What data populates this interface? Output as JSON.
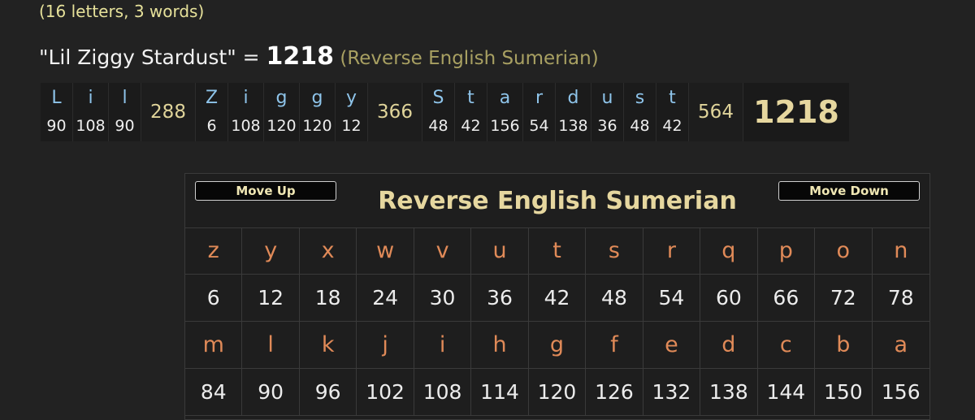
{
  "counts_text": "(16 letters, 3 words)",
  "phrase": {
    "quoted": "\"Lil Ziggy Stardust\"",
    "equals": " = ",
    "total": "1218",
    "cipher_ref": " (Reverse English Sumerian)"
  },
  "breakdown": {
    "words": [
      {
        "letters": [
          [
            "L",
            "90"
          ],
          [
            "i",
            "108"
          ],
          [
            "l",
            "90"
          ]
        ],
        "total": "288"
      },
      {
        "letters": [
          [
            "Z",
            "6"
          ],
          [
            "i",
            "108"
          ],
          [
            "g",
            "120"
          ],
          [
            "g",
            "120"
          ],
          [
            "y",
            "12"
          ]
        ],
        "total": "366"
      },
      {
        "letters": [
          [
            "S",
            "48"
          ],
          [
            "t",
            "42"
          ],
          [
            "a",
            "156"
          ],
          [
            "r",
            "54"
          ],
          [
            "d",
            "138"
          ],
          [
            "u",
            "36"
          ],
          [
            "s",
            "48"
          ],
          [
            "t",
            "42"
          ]
        ],
        "total": "564"
      }
    ],
    "grand_total": "1218"
  },
  "cipher": {
    "title": "Reverse English Sumerian",
    "move_up": "Move Up",
    "move_down": "Move Down",
    "rows": [
      {
        "letters": [
          "z",
          "y",
          "x",
          "w",
          "v",
          "u",
          "t",
          "s",
          "r",
          "q",
          "p",
          "o",
          "n"
        ],
        "values": [
          "6",
          "12",
          "18",
          "24",
          "30",
          "36",
          "42",
          "48",
          "54",
          "60",
          "66",
          "72",
          "78"
        ]
      },
      {
        "letters": [
          "m",
          "l",
          "k",
          "j",
          "i",
          "h",
          "g",
          "f",
          "e",
          "d",
          "c",
          "b",
          "a"
        ],
        "values": [
          "84",
          "90",
          "96",
          "102",
          "108",
          "114",
          "120",
          "126",
          "132",
          "138",
          "144",
          "150",
          "156"
        ]
      }
    ]
  },
  "colors": {
    "background": "#222222",
    "gold": "#e6d79f",
    "letter_blue": "#8ec4ea",
    "letter_orange": "#e08a58"
  }
}
